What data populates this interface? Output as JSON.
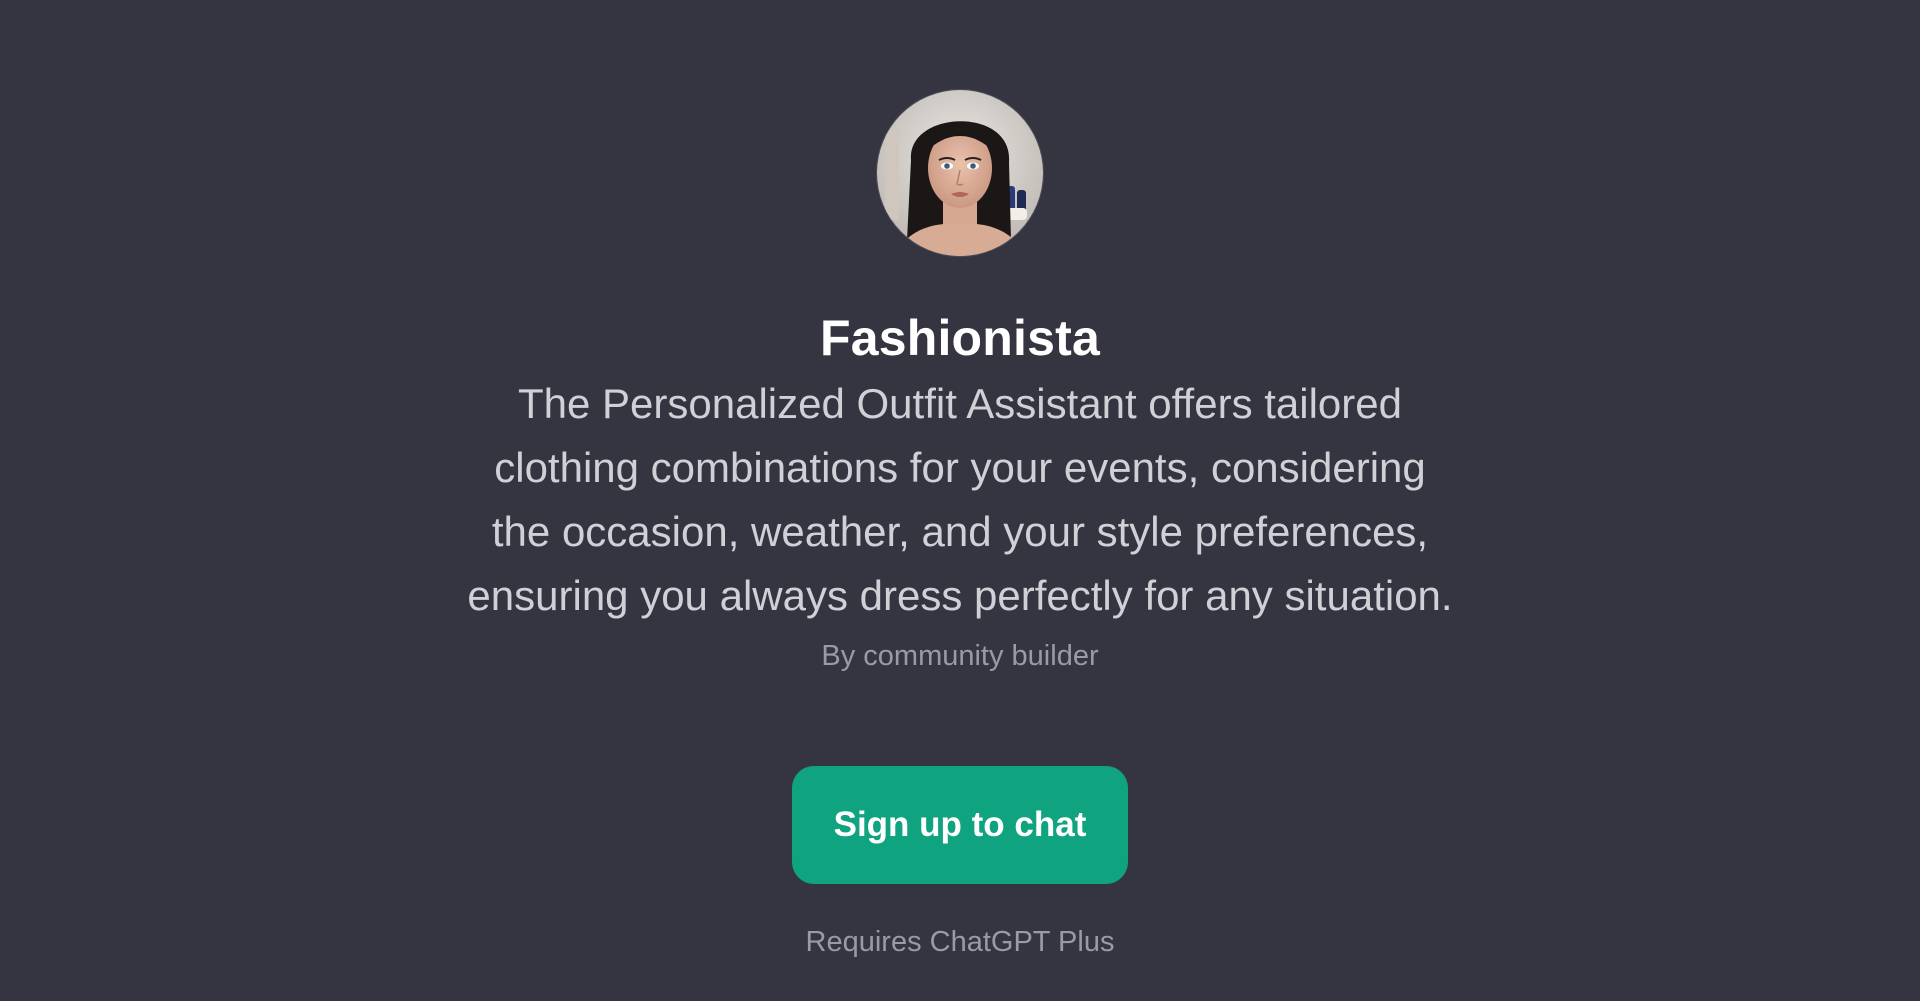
{
  "gpt": {
    "avatar_icon": "portrait-avatar",
    "name": "Fashionista",
    "description": "The Personalized Outfit Assistant offers tailored clothing combinations for your events, considering the occasion, weather, and your style preferences, ensuring you always dress perfectly for any situation.",
    "author": "By community builder"
  },
  "actions": {
    "signup_label": "Sign up to chat"
  },
  "footer": {
    "note": "Requires ChatGPT Plus"
  },
  "colors": {
    "background": "#353541",
    "accent": "#10a37f",
    "title": "#ffffff",
    "description": "#d0d0d7",
    "muted": "#9a9aa6"
  }
}
